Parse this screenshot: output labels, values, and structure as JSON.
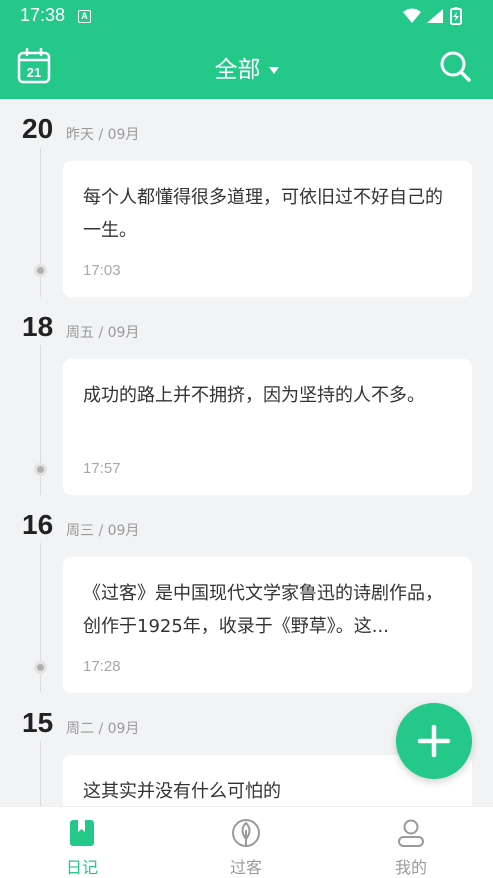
{
  "status_bar": {
    "time": "17:38",
    "notification_badge": "A"
  },
  "header": {
    "calendar_day": "21",
    "filter_title": "全部",
    "accent_color": "#24c98a"
  },
  "entries": [
    {
      "day": "20",
      "meta": "昨天 / 09月",
      "text": "每个人都懂得很多道理，可依旧过不好自己的一生。",
      "time": "17:03"
    },
    {
      "day": "18",
      "meta": "周五 / 09月",
      "text": "成功的路上并不拥挤，因为坚持的人不多。",
      "time": "17:57"
    },
    {
      "day": "16",
      "meta": "周三 / 09月",
      "text": "《过客》是中国现代文学家鲁迅的诗剧作品，创作于1925年，收录于《野草》。这...",
      "time": "17:28"
    },
    {
      "day": "15",
      "meta": "周二 / 09月",
      "text": "这其实并没有什么可怕的",
      "time": ""
    }
  ],
  "bottom_nav": [
    {
      "label": "日记",
      "icon": "bookmark-book-icon",
      "active": true
    },
    {
      "label": "过客",
      "icon": "leaf-icon",
      "active": false
    },
    {
      "label": "我的",
      "icon": "person-icon",
      "active": false
    }
  ]
}
